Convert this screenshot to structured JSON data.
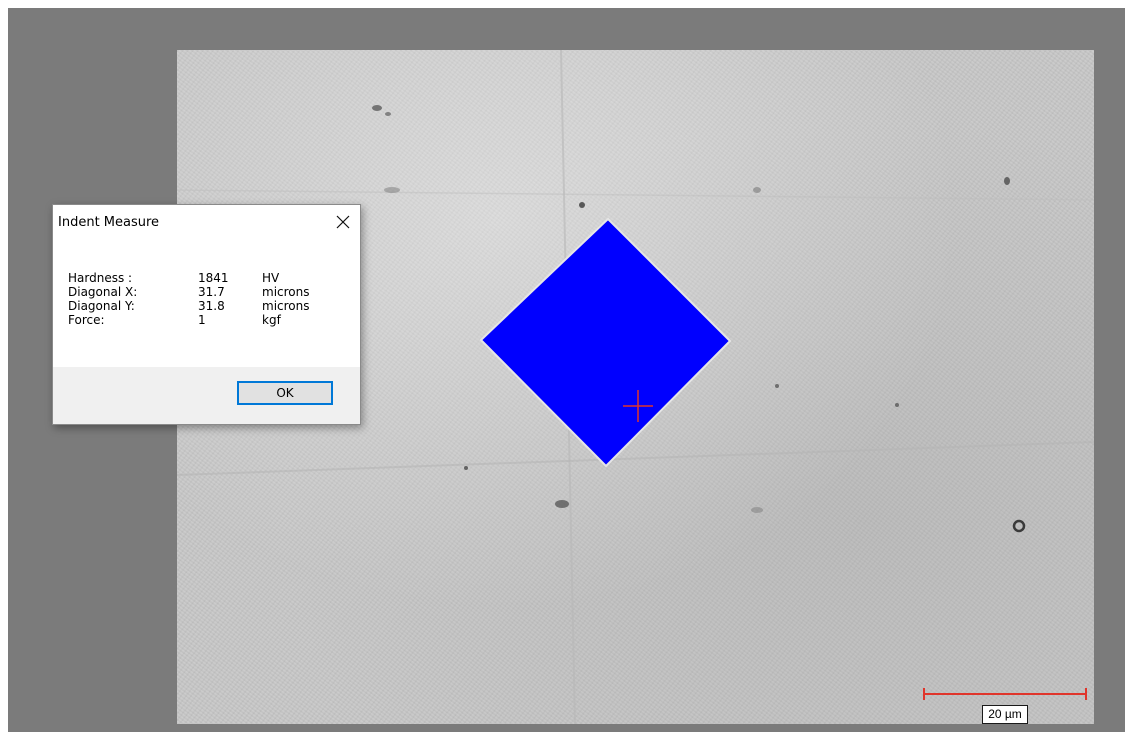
{
  "dialog": {
    "title": "Indent Measure",
    "rows": [
      {
        "label": "Hardness  :",
        "value": "1841",
        "unit": "HV"
      },
      {
        "label": "Diagonal X:",
        "value": "31.7",
        "unit": "microns"
      },
      {
        "label": "Diagonal Y:",
        "value": "31.8",
        "unit": "microns"
      },
      {
        "label": "Force:",
        "value": "1",
        "unit": "kgf"
      }
    ],
    "ok_label": "OK",
    "accent_color": "#0078d7"
  },
  "image": {
    "indent_fill_color": "#0000ff",
    "crosshair_color": "#e0352b",
    "scale_bar_color": "#e0352b",
    "scale_bar_label": "20 µm"
  }
}
